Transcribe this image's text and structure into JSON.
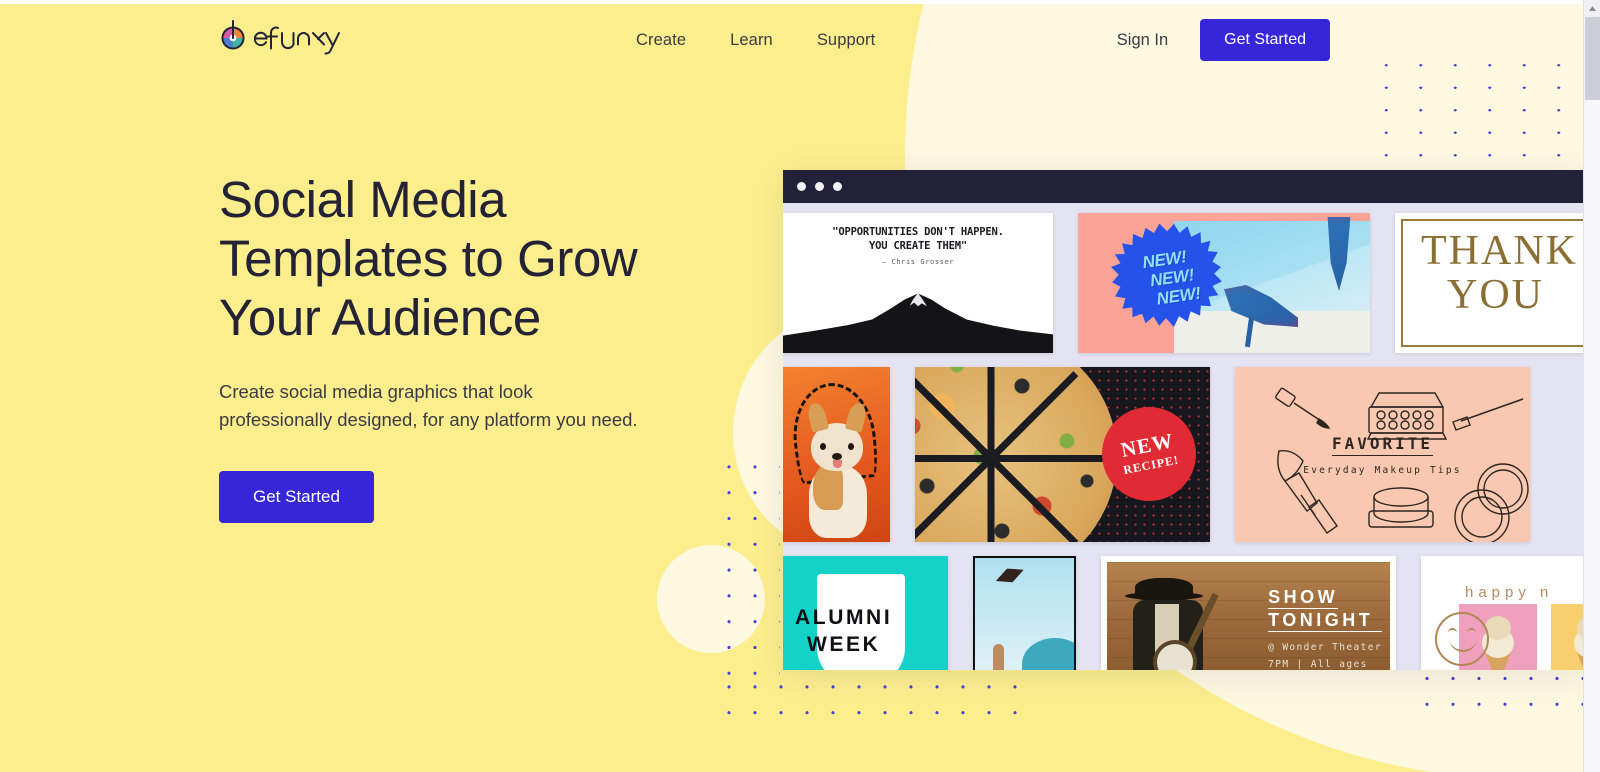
{
  "brand": {
    "logo_text": "befunky",
    "accent_color": "#3726D9",
    "background_color": "#FCEE8D",
    "blob_color": "#FDF8E0",
    "dot_color": "#4A3FD6",
    "heading_color": "#242235"
  },
  "header": {
    "nav_items": [
      {
        "label": "Create"
      },
      {
        "label": "Learn"
      },
      {
        "label": "Support"
      }
    ],
    "sign_in_label": "Sign In",
    "get_started_label": "Get Started"
  },
  "hero": {
    "title_line1": "Social Media",
    "title_line2": "Templates to Grow",
    "title_line3": "Your Audience",
    "subtitle": "Create social media graphics that look professionally designed, for any platform you need.",
    "cta_label": "Get Started"
  },
  "mockup": {
    "window_dots": 3,
    "cards": {
      "quote": {
        "line1": "\"OPPORTUNITIES DON'T HAPPEN.",
        "line2": "YOU CREATE THEM\"",
        "author": "— Chris Grosser"
      },
      "shoes": {
        "badge_line1": "NEW!",
        "badge_line2": "NEW!",
        "badge_line3": "NEW!"
      },
      "thanks": {
        "line1": "THANK",
        "line2": "YOU"
      },
      "pizza": {
        "badge_line1": "NEW",
        "badge_line2": "RECIPE!"
      },
      "makeup": {
        "title": "FAVORITE",
        "subtitle": "Everyday Makeup Tips"
      },
      "alumni": {
        "line1": "ALUMNI",
        "line2": "WEEK"
      },
      "show": {
        "line1": "SHOW",
        "line2": "TONIGHT",
        "venue": "@ Wonder Theater",
        "details": "7PM | All ages"
      },
      "happy": {
        "header": "happy n"
      }
    }
  },
  "scrollbar": {
    "up_arrow": "scroll-up-arrow"
  }
}
